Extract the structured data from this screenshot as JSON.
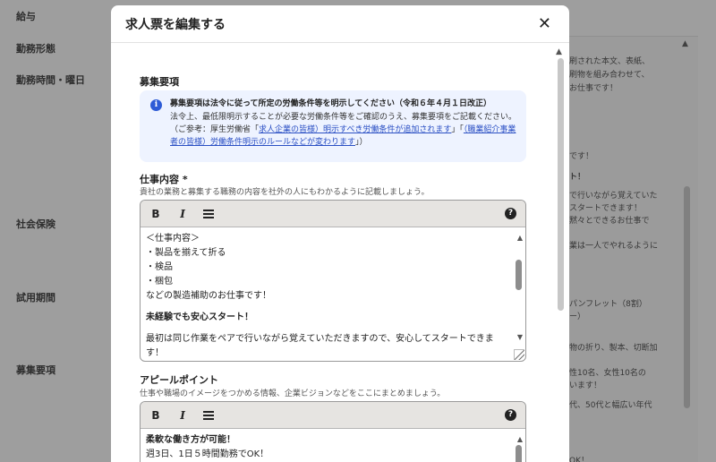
{
  "background": {
    "labels": [
      "給与",
      "勤務形態",
      "勤務時間・曜日",
      "社会保険",
      "試用期間",
      "募集要項"
    ],
    "right_texts": [
      "刷された本文、表紙、",
      "刷物を組み合わせて、",
      "お仕事です！",
      "です！",
      "ト！",
      "で行いながら覚えていた",
      "スタートできます！",
      "黙々とできるお仕事で",
      "業は一人でやれるように",
      "パンフレット（8割）",
      "ー）",
      "物の折り、製本、切断加",
      "性10名、女性10名の",
      "います！",
      "代、50代と幅広い年代",
      "OK！"
    ]
  },
  "modal": {
    "title": "求人票を編集する",
    "close_icon": "close-icon"
  },
  "section": {
    "title": "募集要項"
  },
  "notice": {
    "icon": "info-icon",
    "title": "募集要項は法令に従って所定の労働条件等を明示してください（令和６年４月１日改正）",
    "text_1": "法令上、最低限明示することが必要な労働条件等をご確認のうえ、募集要項をご記載ください。（ご参考：厚生労働省「",
    "link_1": "求人企業の皆様）明示すべき労働条件が追加されます",
    "text_2": "」「",
    "link_2": "（職業紹介事業者の皆様）労働条件明示のルールなどが変わります",
    "text_3": "」）"
  },
  "job_content": {
    "label": "仕事内容 *",
    "help": "貴社の業務と募集する職務の内容を社外の人にもわかるように記載しましょう。",
    "toolbar": {
      "bold": "B",
      "italic": "I",
      "help": "?"
    },
    "lines": [
      "＜仕事内容＞",
      "・製品を揃えて折る",
      "・検品",
      "・梱包",
      "などの製造補助のお仕事です！"
    ],
    "heading": "未経験でも安心スタート！",
    "paragraph": "最初は同じ作業をペアで行いながら覚えていただきますので、安心してスタートできます！"
  },
  "appeal": {
    "label": "アピールポイント",
    "help": "仕事や職場のイメージをつかめる情報、企業ビジョンなどをここにまとめましょう。",
    "toolbar": {
      "bold": "B",
      "italic": "I",
      "help": "?"
    },
    "heading": "柔軟な働き方が可能！",
    "line_1": "週3日、1日５時間勤務でOK！"
  }
}
